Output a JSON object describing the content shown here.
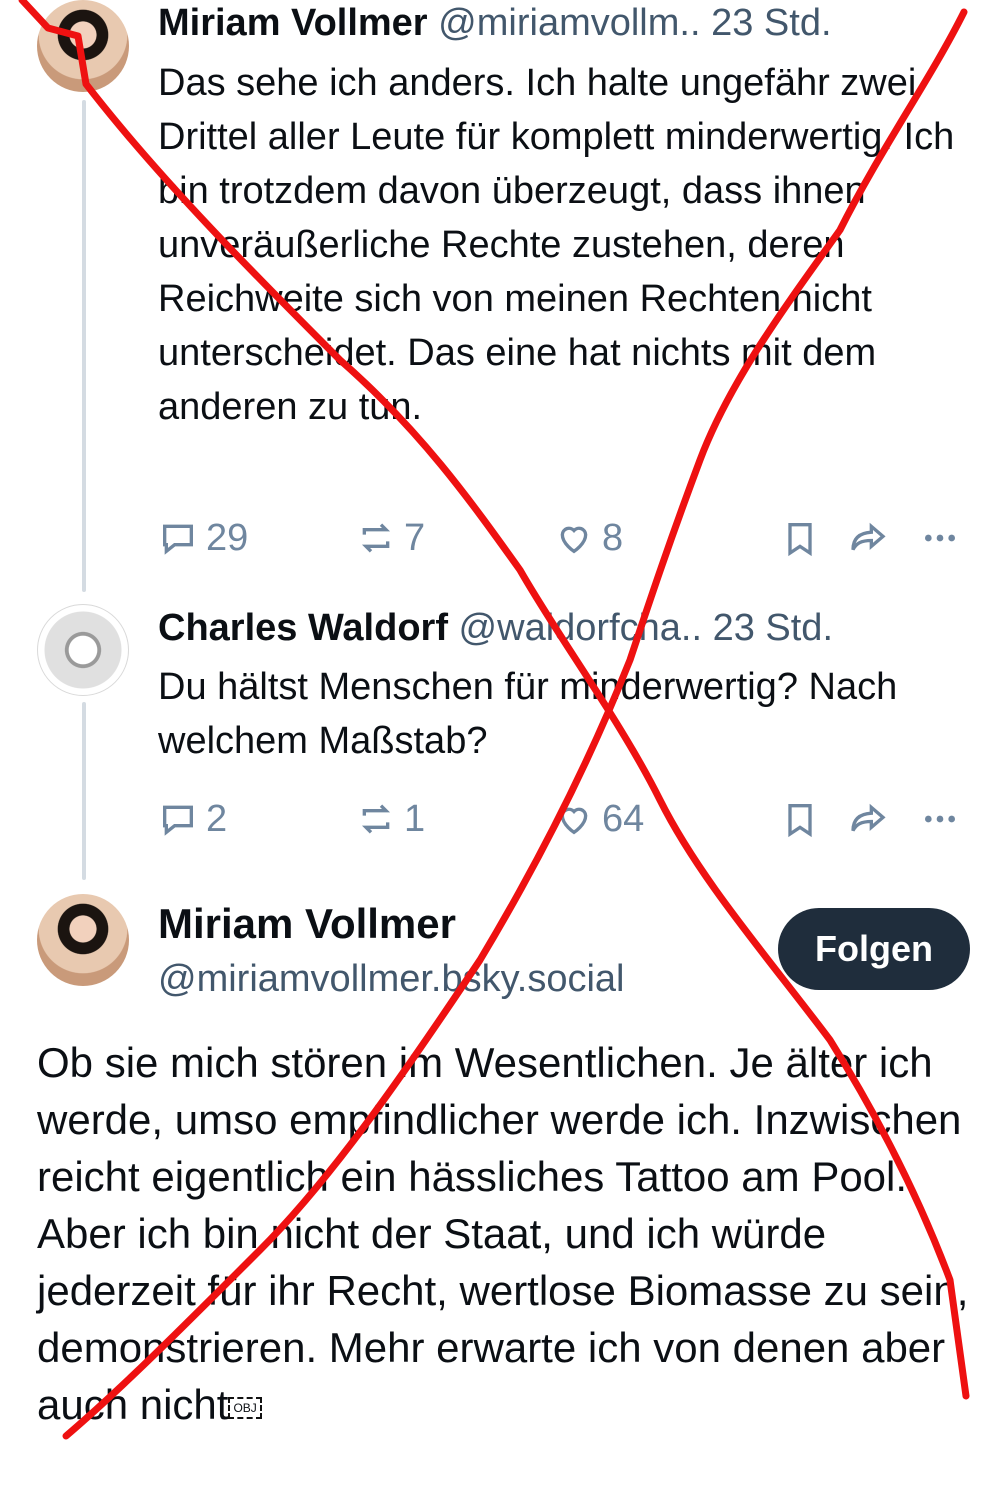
{
  "post1": {
    "name": "Miriam Vollmer",
    "handle": "@miriamvollm..",
    "time": "23 Std.",
    "text": "Das sehe ich anders. Ich halte ungefähr zwei Drittel aller Leute für komplett minderwertig. Ich bin trotzdem davon überzeugt, dass ihnen unveräußerliche Rechte zustehen, deren Reichweite sich von meinen Rechten nicht unterscheidet. Das eine hat nichts mit dem anderen zu tun.",
    "replies": "29",
    "reposts": "7",
    "likes": "8"
  },
  "post2": {
    "name": "Charles Waldorf",
    "handle": "@waldorfcha..",
    "time": "23 Std.",
    "text": "Du hältst Menschen für minderwertig? Nach welchem Maßstab?",
    "replies": "2",
    "reposts": "1",
    "likes": "64"
  },
  "main": {
    "name": "Miriam Vollmer",
    "handle": "@miriamvollmer.bsky.social",
    "follow_label": "Folgen",
    "text": "Ob sie mich stören im Wesentlichen. Je älter ich werde, umso empfindlicher werde ich. Inzwischen reicht eigentlich ein hässliches Tattoo am Pool. Aber ich bin nicht der Staat, und ich würde jederzeit für ihr Recht, wertlose Biomasse zu sein, demonstrieren. Mehr erwarte ich von denen aber auch nicht",
    "obj_label": "OBJ"
  },
  "icons": [
    "reply-icon",
    "repost-icon",
    "like-icon",
    "bookmark-icon",
    "share-icon",
    "more-icon"
  ],
  "colors": {
    "accent_dark": "#1f2d3c",
    "muted": "#6f869f",
    "annotation_red": "#ee1111"
  }
}
